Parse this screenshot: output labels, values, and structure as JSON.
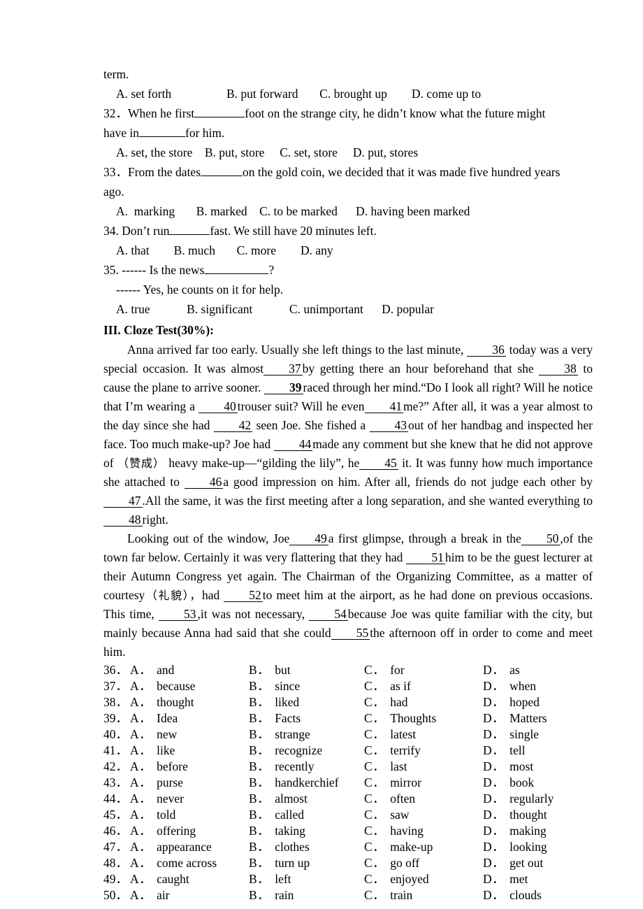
{
  "document": {
    "mc_questions": [
      {
        "id": "q31-options",
        "continuation": "term.",
        "options": [
          {
            "label": "A. set forth",
            "gap_after": 104
          },
          {
            "label": "B. put forward",
            "gap_after": 42
          },
          {
            "label": "C. brought up",
            "gap_after": 52
          },
          {
            "label": "D. come up to",
            "gap_after": 0
          }
        ]
      },
      {
        "id": "q32",
        "number": "32．",
        "stem_part1": "When he first",
        "stem_part2": "foot on the strange city, he didn’t know what the future might",
        "stem_part3": "have in",
        "stem_part4": "for him.",
        "options": [
          {
            "label": "A. set, the store",
            "gap_after": 22
          },
          {
            "label": "B. put, store",
            "gap_after": 26
          },
          {
            "label": "C. set, store",
            "gap_after": 26
          },
          {
            "label": "D. put, stores",
            "gap_after": 0
          }
        ]
      },
      {
        "id": "q33",
        "number": "33．",
        "stem_part1": "From the dates",
        "stem_part2": "on the gold coin, we decided that it was made five hundred years",
        "stem_part3": "ago.",
        "options": [
          {
            "label": "A.  marking",
            "gap_after": 62
          },
          {
            "label": "B. marked",
            "gap_after": 26
          },
          {
            "label": "C. to be marked",
            "gap_after": 44
          },
          {
            "label": "D. having been marked",
            "gap_after": 0
          }
        ]
      },
      {
        "id": "q34",
        "number": "34.",
        "stem_part1": "Don’t run",
        "stem_part2": "fast. We still have 20 minutes left.",
        "options": [
          {
            "label": "A. that",
            "gap_after": 54
          },
          {
            "label": "B. much",
            "gap_after": 48
          },
          {
            "label": "C. more",
            "gap_after": 46
          },
          {
            "label": "D. any",
            "gap_after": 0
          }
        ]
      },
      {
        "id": "q35",
        "number": "35.",
        "stem_part1": "------ Is the news",
        "stem_part2": "?",
        "stem_part3": "------ Yes, he counts on it for help.",
        "options": [
          {
            "label": "A. true",
            "gap_after": 84
          },
          {
            "label": "B. significant",
            "gap_after": 80
          },
          {
            "label": "C. unimportant",
            "gap_after": 42
          },
          {
            "label": "D. popular",
            "gap_after": 0
          }
        ]
      }
    ],
    "cloze_heading": "III. Cloze Test(30%):",
    "cloze_passage": {
      "para1": {
        "t1": "Anna arrived far too early. Usually she left things to the last minute,",
        "g36": "36",
        "t2": "today was a very special occasion. It was almost",
        "g37": "37",
        "t3": "by getting there an hour beforehand that she",
        "g38": "38",
        "t4": "to cause the plane to arrive sooner.",
        "g39": "39",
        "t5": "raced through her mind.“Do I look all right? Will he notice that I’m wearing a",
        "g40": "40",
        "t6": "trouser suit? Will he even",
        "g41": "41",
        "t7": "me?” After all, it was a year almost to the day since she had",
        "g42": "42",
        "t8": "seen Joe. She fished a",
        "g43": "43",
        "t9": "out of her handbag and inspected her face. Too much make-up? Joe had",
        "g44": "44",
        "t10": "made any comment but she knew that he did not approve of",
        "cn1": "（赞成）",
        "t11": "heavy make-up—“gilding the lily”, he",
        "g45": "45",
        "t12": "it. It was funny how much importance she attached to",
        "g46": "46",
        "t13": "a good impression on him. After all, friends do not judge each other by",
        "g47": "47",
        "t14": ".All the same, it was the first meeting after a long separation, and she wanted everything to",
        "g48": "48",
        "t15": "right."
      },
      "para2": {
        "t1": "Looking out of the window, Joe",
        "g49": "49",
        "t2": "a first glimpse, through a break in the",
        "g50": "50",
        "t3": ",of the town far below. Certainly it was very flattering that they had",
        "g51": "51",
        "t4": "him to be the guest lecturer at their Autumn Congress yet again. The Chairman of the Organizing Committee, as a matter of courtesy",
        "cn1": "（礼貌），",
        "t5": "had",
        "g52": "52",
        "t6": "to meet him at the airport, as he had done on previous occasions. This time,",
        "g53": "53",
        "t7": ",it was not necessary,",
        "g54": "54",
        "t8": "because Joe was quite familiar with   the city, but mainly because Anna had said that she could",
        "g55": "55",
        "t9": "the afternoon off in order to come and meet him."
      }
    },
    "answer_options": [
      {
        "num": "36．",
        "a": "and",
        "b": "but",
        "c": "for",
        "d": "as"
      },
      {
        "num": "37．",
        "a": "because",
        "b": "since",
        "c": "as if",
        "d": "when"
      },
      {
        "num": "38．",
        "a": "thought",
        "b": "liked",
        "c": "had",
        "d": "hoped"
      },
      {
        "num": "39．",
        "a": "Idea",
        "b": "Facts",
        "c": "Thoughts",
        "d": "Matters"
      },
      {
        "num": "40．",
        "a": "new",
        "b": "strange",
        "c": "latest",
        "d": "single"
      },
      {
        "num": "41．",
        "a": "like",
        "b": "recognize",
        "c": "terrify",
        "d": "tell"
      },
      {
        "num": "42．",
        "a": "before",
        "b": "recently",
        "c": "last",
        "d": "most"
      },
      {
        "num": "43．",
        "a": "purse",
        "b": "handkerchief",
        "c": "mirror",
        "d": "book"
      },
      {
        "num": "44．",
        "a": "never",
        "b": "almost",
        "c": "often",
        "d": "regularly"
      },
      {
        "num": "45．",
        "a": "told",
        "b": "called",
        "c": "saw",
        "d": "thought"
      },
      {
        "num": "46．",
        "a": "offering",
        "b": "taking",
        "c": "having",
        "d": "making"
      },
      {
        "num": "47．",
        "a": "appearance",
        "b": "clothes",
        "c": "make-up",
        "d": "looking"
      },
      {
        "num": "48．",
        "a": "come across",
        "b": "turn up",
        "c": "go off",
        "d": "get out"
      },
      {
        "num": "49．",
        "a": "caught",
        "b": "left",
        "c": "enjoyed",
        "d": "met"
      },
      {
        "num": "50．",
        "a": "air",
        "b": "rain",
        "c": "train",
        "d": "clouds"
      }
    ],
    "option_letters": {
      "a": "A．",
      "b": "B．",
      "c": "C．",
      "d": "D．"
    }
  }
}
